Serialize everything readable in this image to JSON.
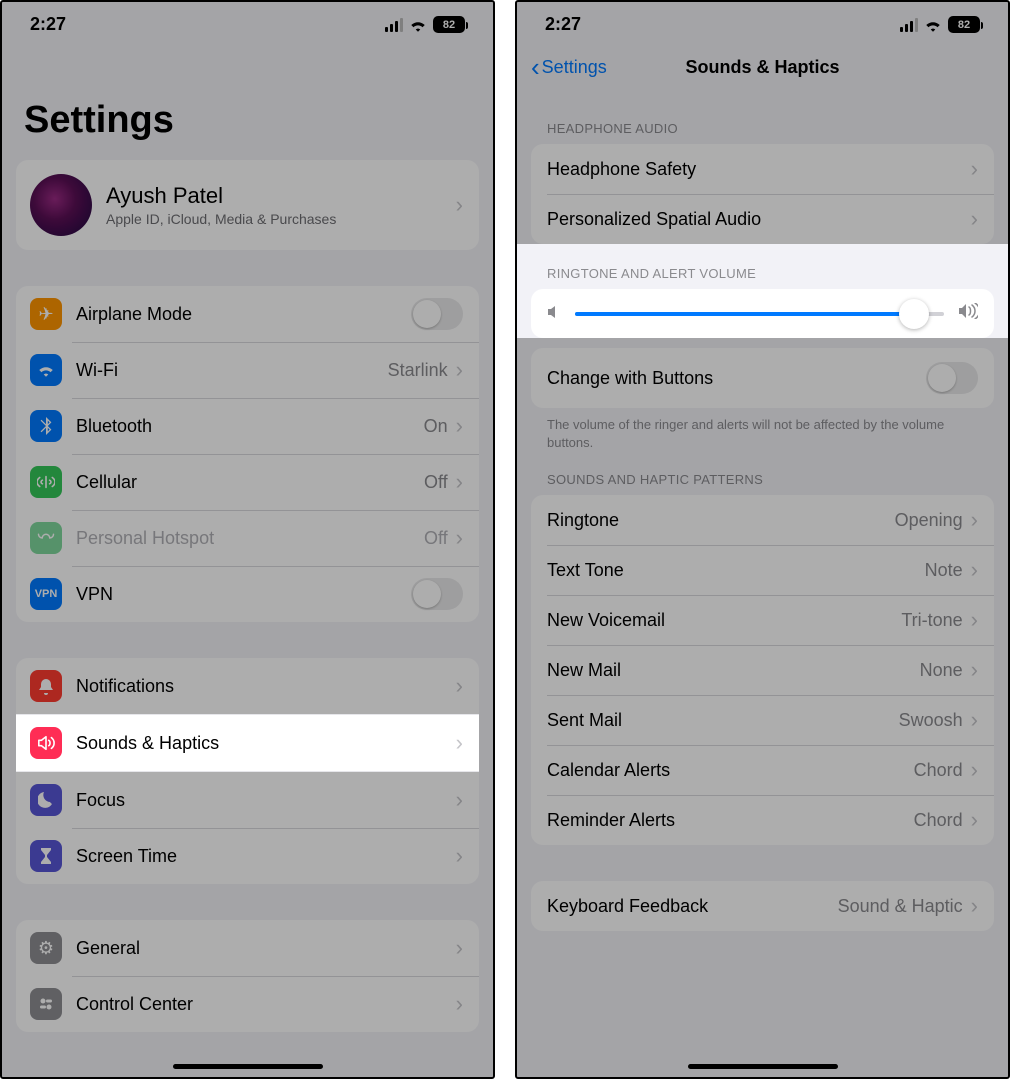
{
  "status": {
    "time": "2:27",
    "battery": "82"
  },
  "left": {
    "title": "Settings",
    "profile": {
      "name": "Ayush Patel",
      "sub": "Apple ID, iCloud, Media & Purchases"
    },
    "rows1": {
      "airplane": "Airplane Mode",
      "wifi": "Wi-Fi",
      "wifi_val": "Starlink",
      "bt": "Bluetooth",
      "bt_val": "On",
      "cell": "Cellular",
      "cell_val": "Off",
      "hotspot": "Personal Hotspot",
      "hotspot_val": "Off",
      "vpn": "VPN"
    },
    "rows2": {
      "notif": "Notifications",
      "sounds": "Sounds & Haptics",
      "focus": "Focus",
      "screentime": "Screen Time"
    },
    "rows3": {
      "general": "General",
      "cc": "Control Center"
    }
  },
  "right": {
    "back": "Settings",
    "title": "Sounds & Haptics",
    "headphone_hdr": "Headphone Audio",
    "hp_safety": "Headphone Safety",
    "spatial": "Personalized Spatial Audio",
    "vol_hdr": "Ringtone and Alert Volume",
    "slider_pct": 92,
    "change_btn": "Change with Buttons",
    "change_footer": "The volume of the ringer and alerts will not be affected by the volume buttons.",
    "patterns_hdr": "Sounds and Haptic Patterns",
    "patterns": [
      {
        "label": "Ringtone",
        "value": "Opening"
      },
      {
        "label": "Text Tone",
        "value": "Note"
      },
      {
        "label": "New Voicemail",
        "value": "Tri-tone"
      },
      {
        "label": "New Mail",
        "value": "None"
      },
      {
        "label": "Sent Mail",
        "value": "Swoosh"
      },
      {
        "label": "Calendar Alerts",
        "value": "Chord"
      },
      {
        "label": "Reminder Alerts",
        "value": "Chord"
      }
    ],
    "kb_label": "Keyboard Feedback",
    "kb_val": "Sound & Haptic"
  }
}
